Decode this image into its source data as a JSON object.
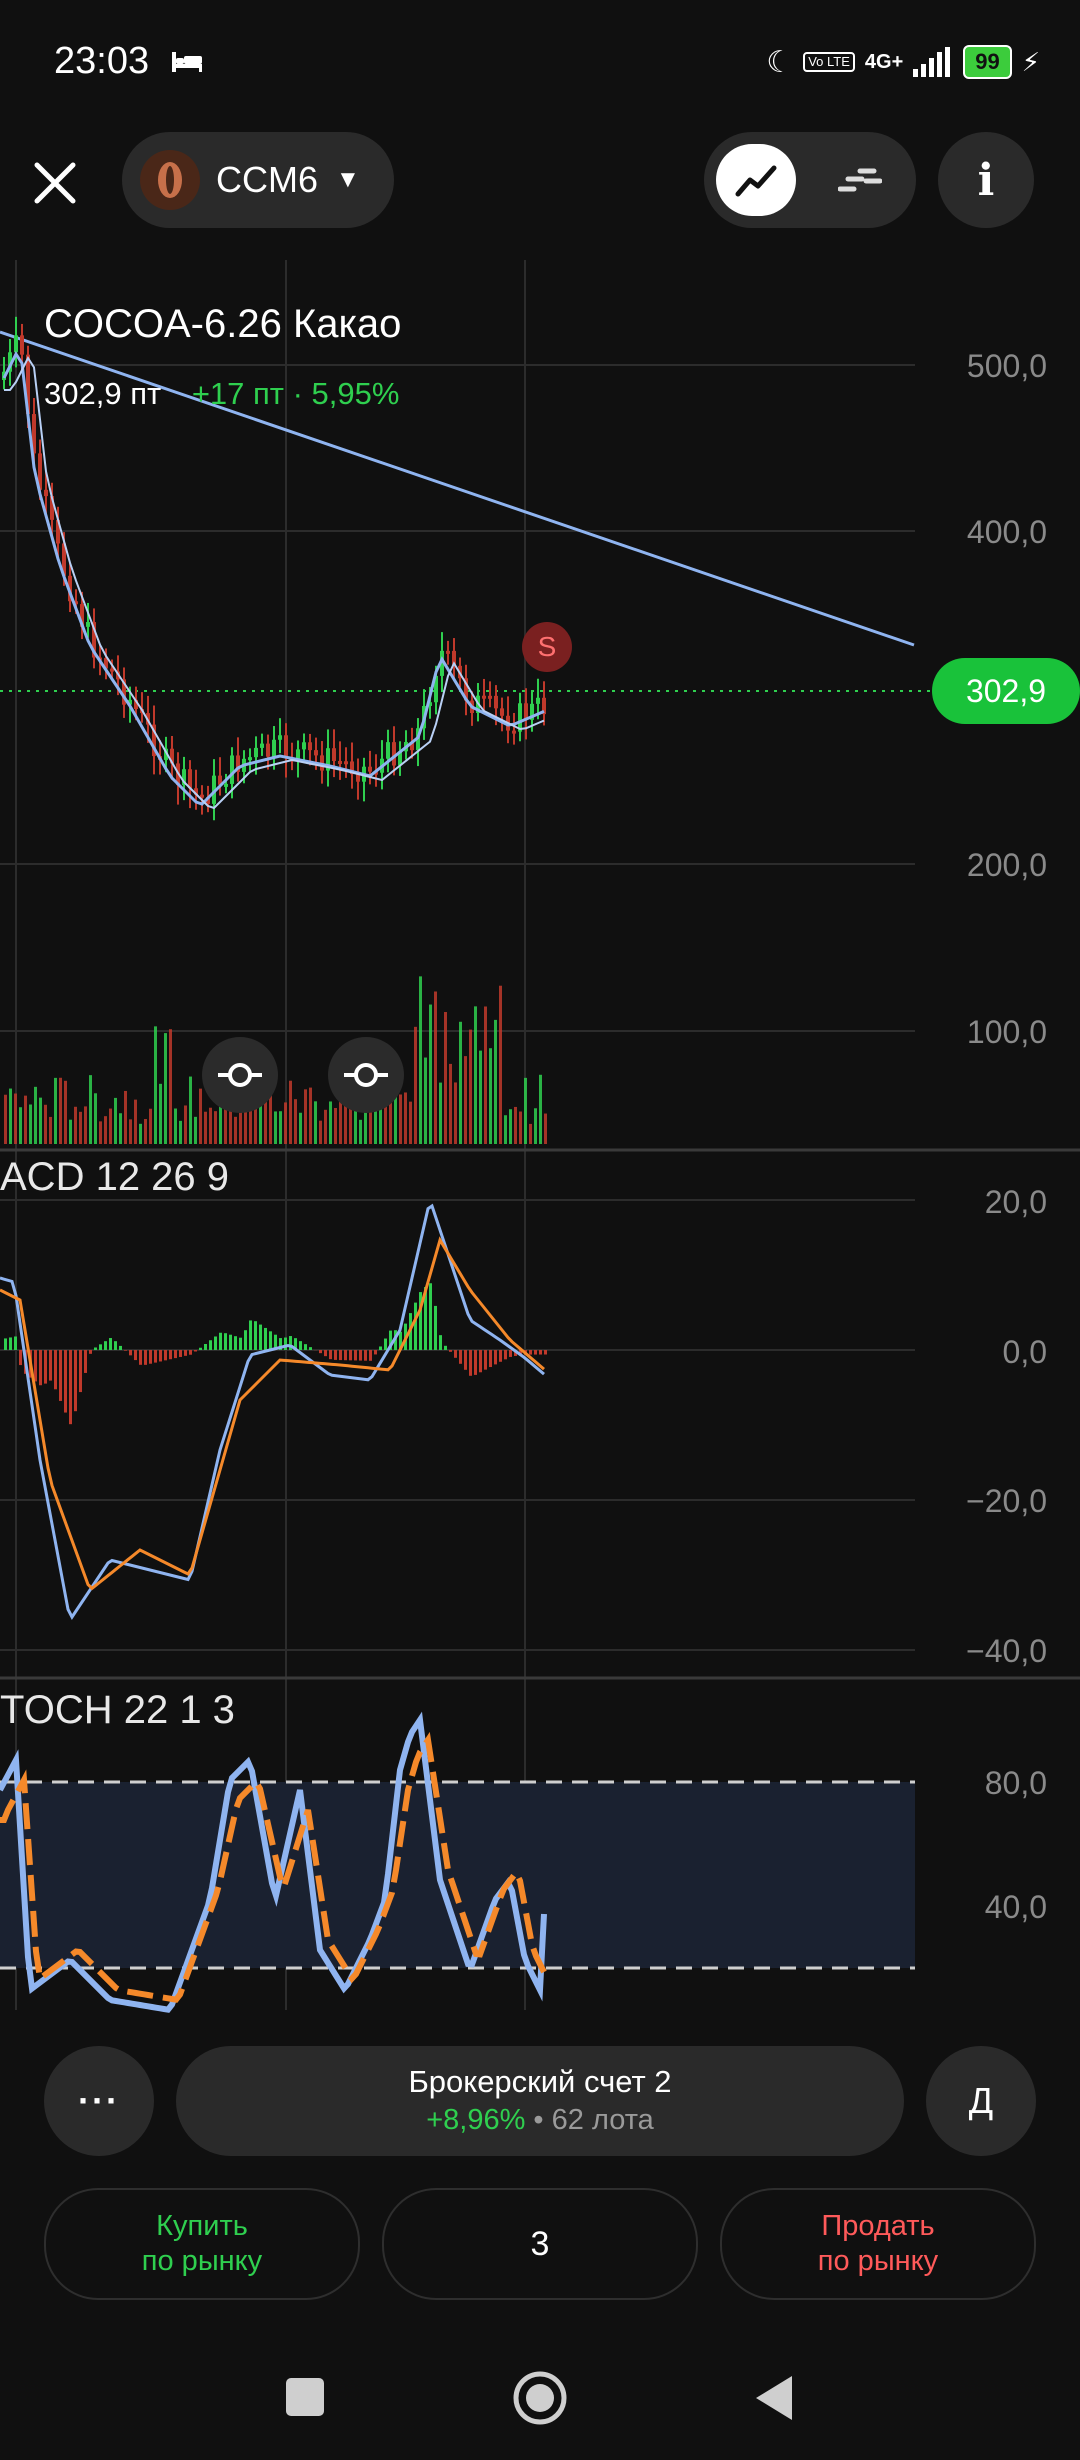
{
  "status_bar": {
    "time": "23:03",
    "network": "4G+",
    "volte": "Vo LTE",
    "battery": "99"
  },
  "header": {
    "ticker": "CCM6",
    "info_symbol": "i"
  },
  "chart": {
    "title": "COCOA-6.26 Какао",
    "last_price": "302,9 пт",
    "change": "+17 пт · 5,95%",
    "price_badge": "302,9",
    "signal_badge": "S",
    "price_axis": [
      "500,0",
      "400,0",
      "200,0",
      "100,0"
    ],
    "macd": {
      "label": "ACD 12 26 9",
      "axis": [
        "20,0",
        "0,0",
        "−20,0",
        "−40,0"
      ]
    },
    "stoch": {
      "label": "TOCH 22 1 3",
      "axis": [
        "80,0",
        "40,0"
      ]
    },
    "colors": {
      "up": "#2fcf4f",
      "down": "#c0392b",
      "ma": "#8fb4f0",
      "trend": "#8fb4f0",
      "signal": "#f5892a"
    }
  },
  "bottom_panel": {
    "more_label": "···",
    "account_name": "Брокерский счет 2",
    "account_change": "+8,96%",
    "account_separator": " • ",
    "account_lots": "62 лота",
    "d_label": "Д",
    "buy_line1": "Купить",
    "buy_line2": "по рынку",
    "quantity": "3",
    "sell_line1": "Продать",
    "sell_line2": "по рынку"
  }
}
